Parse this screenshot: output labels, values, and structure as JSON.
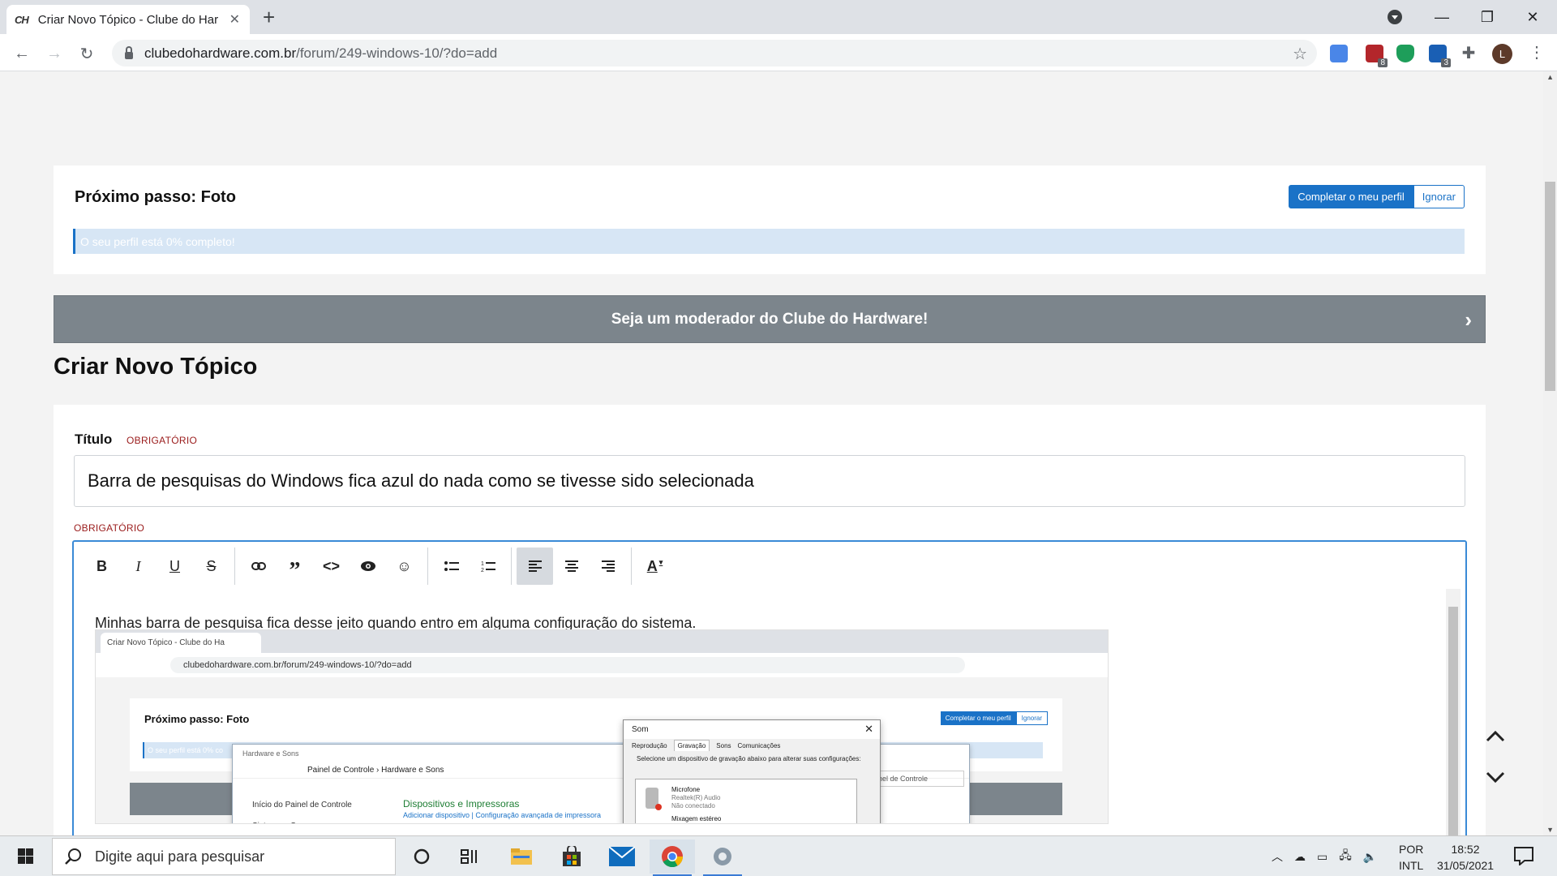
{
  "browser": {
    "tab_title": "Criar Novo Tópico - Clube do Hardware",
    "tab_favicon": "CH",
    "url_domain": "clubedohardware.com.br",
    "url_path": "/forum/249-windows-10/?do=add",
    "profile_initial": "L",
    "ext_badges": [
      "8",
      "3"
    ]
  },
  "profile_step": {
    "title": "Próximo passo: Foto",
    "complete_button": "Completar o meu perfil",
    "ignore_button": "Ignorar",
    "progress_text": "O seu perfil está 0% completo!",
    "progress_value": 0
  },
  "moderator_banner": {
    "text": "Seja um moderador do Clube do Hardware!"
  },
  "page_title": "Criar Novo Tópico",
  "form": {
    "title_label": "Título",
    "required_label": "OBRIGATÓRIO",
    "title_value": "Barra de pesquisas do Windows fica azul do nada como se tivesse sido selecionada",
    "body_required_label": "OBRIGATÓRIO",
    "body_text": "Minhas barra de pesquisa fica desse jeito quando entro em alguma configuração do sistema."
  },
  "embedded_screenshot": {
    "tab_title": "Criar Novo Tópico - Clube do Ha",
    "url": "clubedohardware.com.br/forum/249-windows-10/?do=add",
    "step_title": "Próximo passo: Foto",
    "btn_complete": "Completar o meu perfil",
    "btn_ignore": "Ignorar",
    "progress_text": "O seu perfil está 0% co",
    "cp_header": "Hardware e Sons",
    "cp_crumb": "Painel de Controle  ›  Hardware e Sons",
    "cp_side1": "Início do Painel de Controle",
    "cp_side2": "Sistema e Segurança",
    "cp_devices": "Dispositivos e Impressoras",
    "cp_devices_sub": "Adicionar dispositivo   |   Configuração avançada de impressora",
    "cp_search": "ainel de Controle",
    "sound_title": "Som",
    "sound_tabs": [
      "Reprodução",
      "Gravação",
      "Sons",
      "Comunicações"
    ],
    "sound_desc": "Selecione um dispositivo de gravação abaixo para alterar suas configurações:",
    "device_name": "Microfone",
    "device_driver": "Realtek(R) Audio",
    "device_status": "Não conectado",
    "device2_name": "Mixagem estéreo"
  },
  "taskbar": {
    "search_placeholder": "Digite aqui para pesquisar",
    "lang_top": "POR",
    "lang_bottom": "INTL",
    "time": "18:52",
    "date": "31/05/2021"
  },
  "colors": {
    "accent": "#1a72c7",
    "banner": "#7c858c",
    "required": "#9a1b1b",
    "editor_focus": "#3a8ad6"
  }
}
